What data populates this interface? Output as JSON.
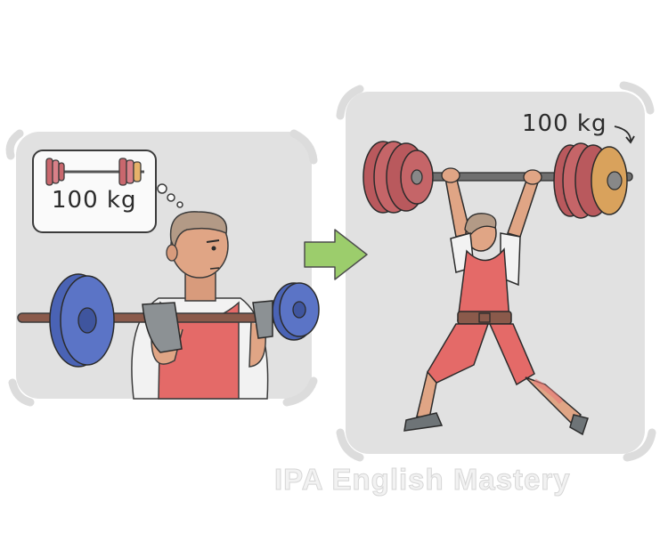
{
  "illustration": {
    "thought_bubble_weight": "100 kg",
    "overhead_weight": "100 kg"
  },
  "watermark": "IPA English Mastery",
  "colors": {
    "panel": "#e1e1e1",
    "arrow": "#9ccd6c",
    "singlet": "#e46a68",
    "blue_plate": "#4a63b5",
    "red_plate": "#b9595d",
    "gold_plate": "#d9a25c"
  }
}
